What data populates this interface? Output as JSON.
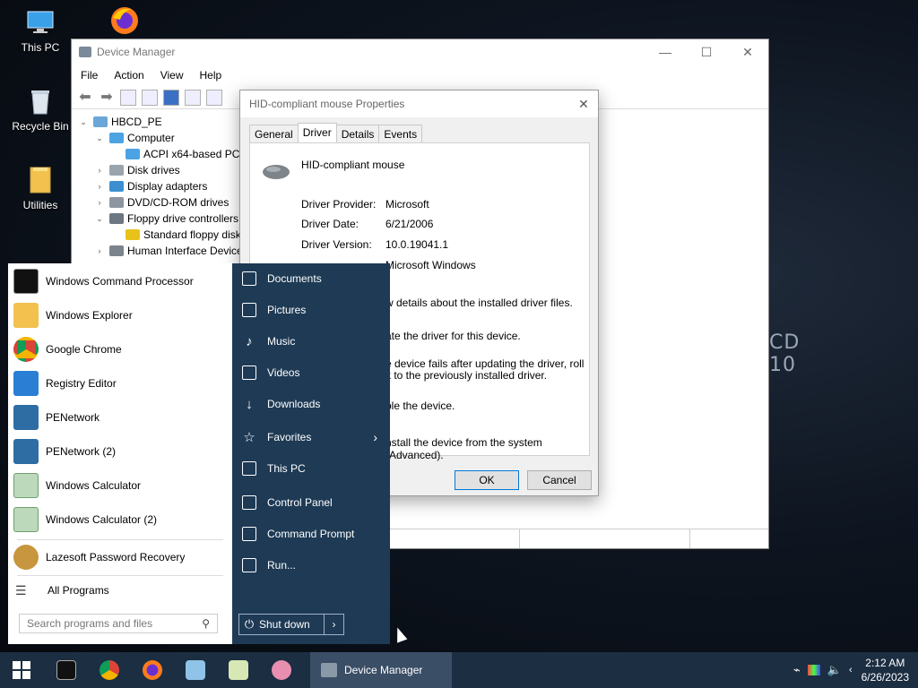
{
  "desktop": {
    "icons": [
      {
        "label": "This PC"
      },
      {
        "label": "Recycle Bin"
      },
      {
        "label": "Utilities"
      }
    ],
    "wallpaper_text_1": "CD",
    "wallpaper_text_2": "10"
  },
  "device_manager": {
    "title": "Device Manager",
    "menu": [
      "File",
      "Action",
      "View",
      "Help"
    ],
    "tree": [
      {
        "label": "HBCD_PE",
        "expander": "⌄"
      },
      {
        "label": "Computer",
        "expander": "⌄"
      },
      {
        "label": "ACPI x64-based PC",
        "expander": ""
      },
      {
        "label": "Disk drives",
        "expander": "›"
      },
      {
        "label": "Display adapters",
        "expander": "›"
      },
      {
        "label": "DVD/CD-ROM drives",
        "expander": "›"
      },
      {
        "label": "Floppy drive controllers",
        "expander": "⌄"
      },
      {
        "label": "Standard floppy disk",
        "expander": ""
      },
      {
        "label": "Human Interface Device",
        "expander": "›"
      }
    ]
  },
  "properties": {
    "title": "HID-compliant mouse Properties",
    "tabs": [
      "General",
      "Driver",
      "Details",
      "Events"
    ],
    "device_name": "HID-compliant mouse",
    "fields": [
      {
        "key": "Driver Provider:",
        "value": "Microsoft"
      },
      {
        "key": "Driver Date:",
        "value": "6/21/2006"
      },
      {
        "key": "Driver Version:",
        "value": "10.0.19041.1"
      }
    ],
    "signer_partial": "Microsoft Windows",
    "desc_1": "w details about the installed driver files.",
    "desc_2": "ate the driver for this device.",
    "desc_3a": "e device fails after updating the driver, roll",
    "desc_3b": "k to the previously installed driver.",
    "desc_4": "ble the device.",
    "desc_5": "nstall the device from the system (Advanced).",
    "ok": "OK",
    "cancel": "Cancel"
  },
  "start_menu": {
    "apps": [
      {
        "label": "Windows Command Processor",
        "color": "#111111"
      },
      {
        "label": "Windows Explorer",
        "color": "#f2c14e"
      },
      {
        "label": "Google Chrome",
        "color": "#db4437"
      },
      {
        "label": "Registry Editor",
        "color": "#2a7fd4"
      },
      {
        "label": "PENetwork",
        "color": "#2e6da4"
      },
      {
        "label": "PENetwork (2)",
        "color": "#2e6da4"
      },
      {
        "label": "Windows Calculator",
        "color": "#8fbc8f"
      },
      {
        "label": "Windows Calculator (2)",
        "color": "#8fbc8f"
      },
      {
        "label": "Lazesoft Password Recovery",
        "color": "#c8963e"
      }
    ],
    "all_programs": "All Programs",
    "search_placeholder": "Search programs and files",
    "places": [
      "Documents",
      "Pictures",
      "Music",
      "Videos",
      "Downloads",
      "Favorites",
      "This PC",
      "Control Panel",
      "Command Prompt",
      "Run..."
    ],
    "shutdown": "Shut down"
  },
  "taskbar": {
    "active_task": "Device Manager",
    "time": "2:12 AM",
    "date": "6/26/2023"
  }
}
